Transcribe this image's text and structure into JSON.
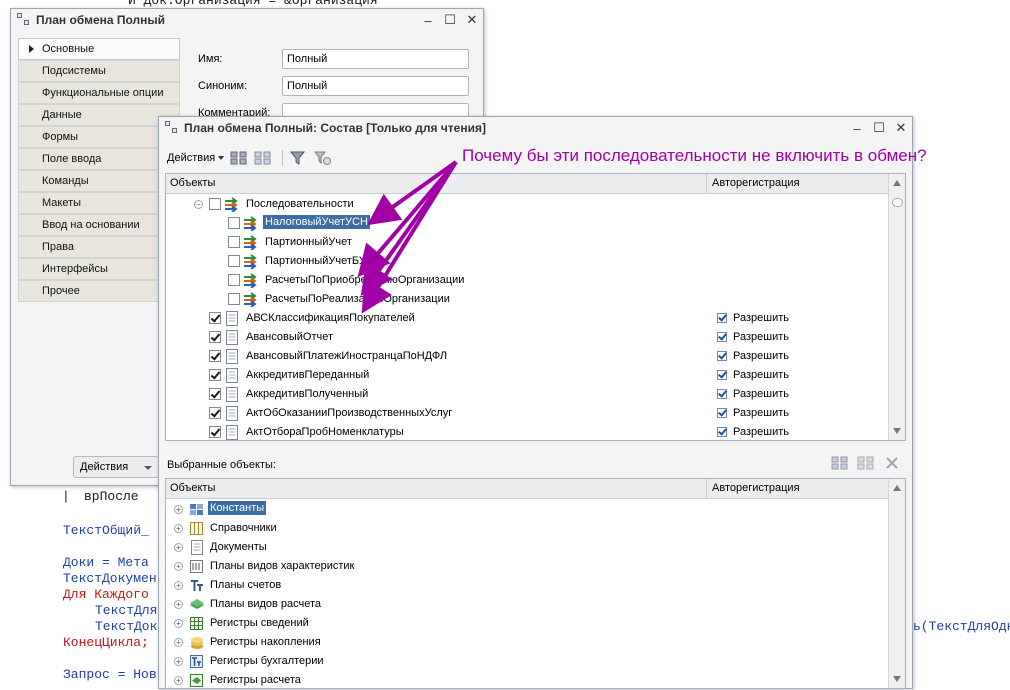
{
  "code": {
    "line_top": "И Док.Организация = &Организация",
    "line_gutter": "|",
    "line_vr": "врПосле",
    "line_texto": "ТекстОбщий_",
    "line_doki": "Доки = Мета",
    "line_textdoc": "ТекстДокумен",
    "line_dlya": "Для Каждого",
    "line_textdlya1": "ТекстДля",
    "line_textdoc2": "ТекстДок",
    "line_konec": "КонецЦикла;",
    "line_zapros": "Запрос = Нов",
    "line_right_tail": "ь(ТекстДляОдн"
  },
  "win1": {
    "title": "План обмена Полный",
    "tabs": [
      "Основные",
      "Подсистемы",
      "Функциональные опции",
      "Данные",
      "Формы",
      "Поле ввода",
      "Команды",
      "Макеты",
      "Ввод на основании",
      "Права",
      "Интерфейсы",
      "Прочее"
    ],
    "fields": {
      "name_label": "Имя:",
      "name_value": "Полный",
      "synonym_label": "Синоним:",
      "synonym_value": "Полный",
      "comment_label": "Комментарий:"
    },
    "actions_label": "Действия"
  },
  "win2": {
    "title": "План обмена Полный: Состав [Только для чтения]",
    "toolbar": {
      "actions_label": "Действия"
    },
    "top_grid": {
      "col_objects": "Объекты",
      "col_autoreg": "Авторегистрация",
      "group_label": "Последовательности",
      "sequences": [
        "НалоговыйУчетУСН",
        "ПартионныйУчет",
        "ПартионныйУчетБУ",
        "РасчетыПоПриобретениюОрганизации",
        "РасчетыПоРеализацииОрганизации"
      ],
      "documents": [
        {
          "name": "АВСКлассификацияПокупателей",
          "autoreg": "Разрешить"
        },
        {
          "name": "АвансовыйОтчет",
          "autoreg": "Разрешить"
        },
        {
          "name": "АвансовыйПлатежИностранцаПоНДФЛ",
          "autoreg": "Разрешить"
        },
        {
          "name": "АккредитивПереданный",
          "autoreg": "Разрешить"
        },
        {
          "name": "АккредитивПолученный",
          "autoreg": "Разрешить"
        },
        {
          "name": "АктОбОказанииПроизводственныхУслуг",
          "autoreg": "Разрешить"
        },
        {
          "name": "АктОтбораПробНоменклатуры",
          "autoreg": "Разрешить"
        }
      ]
    },
    "selected_label": "Выбранные объекты:",
    "bottom_grid": {
      "col_objects": "Объекты",
      "col_autoreg": "Авторегистрация",
      "items": [
        "Константы",
        "Справочники",
        "Документы",
        "Планы видов характеристик",
        "Планы счетов",
        "Планы видов расчета",
        "Регистры сведений",
        "Регистры накопления",
        "Регистры бухгалтерии",
        "Регистры расчета"
      ]
    }
  },
  "annotation": {
    "text": "Почему бы эти последовательности не включить в обмен?",
    "color": "#a000a6"
  },
  "colors": {
    "selection": "#3d6da5",
    "window_bg": "#f4f4f4",
    "tab_bg": "#e8e5dc"
  }
}
